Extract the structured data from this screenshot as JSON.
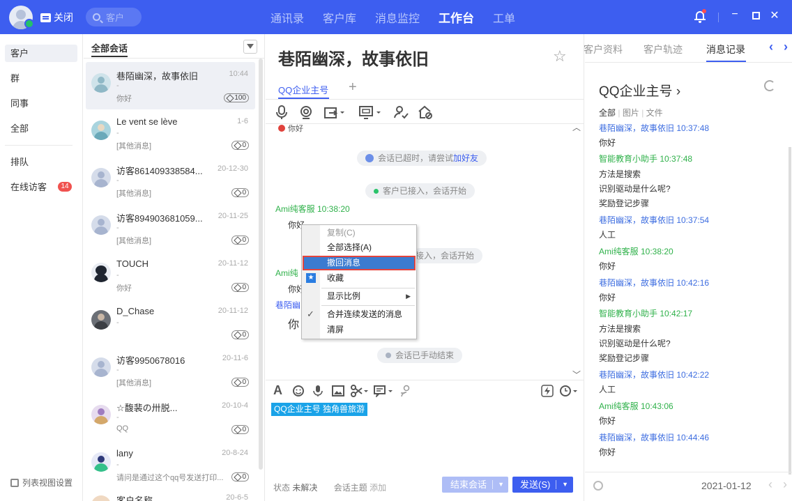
{
  "topbar": {
    "close_label": "关闭",
    "search_placeholder": "客户",
    "tabs": [
      {
        "label": "通讯录"
      },
      {
        "label": "客户库"
      },
      {
        "label": "消息监控"
      },
      {
        "label": "工作台",
        "active": true
      },
      {
        "label": "工单"
      }
    ],
    "accent_color": "#3d5ef0"
  },
  "left_nav": {
    "items": [
      {
        "label": "客户",
        "active": true
      },
      {
        "label": "群"
      },
      {
        "label": "同事"
      },
      {
        "label": "全部"
      },
      {
        "label": "排队"
      },
      {
        "label": "在线访客",
        "badge": "14"
      }
    ],
    "settings_label": "列表视图设置"
  },
  "conversations": {
    "title": "全部会话",
    "items": [
      {
        "name": "巷陌幽深，故事依旧",
        "time": "10:44",
        "sub": "-",
        "msg": "你好",
        "badge": "100",
        "active": true
      },
      {
        "name": "Le vent se lève",
        "time": "1-6",
        "sub": "-",
        "msg": "[其他消息]",
        "badge": "0"
      },
      {
        "name": "访客861409338584...",
        "time": "20-12-30",
        "sub": "-",
        "msg": "[其他消息]",
        "badge": "0"
      },
      {
        "name": "访客894903681059...",
        "time": "20-11-25",
        "sub": "-",
        "msg": "[其他消息]",
        "badge": "0"
      },
      {
        "name": "TOUCH",
        "time": "20-11-12",
        "sub": "-",
        "msg": "你好",
        "badge": "0"
      },
      {
        "name": "D_Chase",
        "time": "20-11-12",
        "sub": "-",
        "msg": "",
        "badge": "0"
      },
      {
        "name": "访客9950678016",
        "time": "20-11-6",
        "sub": "-",
        "msg": "[其他消息]",
        "badge": "0"
      },
      {
        "name": "☆馥裴の卅脱...",
        "time": "20-10-4",
        "sub": "-",
        "msg": "QQ",
        "badge": "0"
      },
      {
        "name": "lany",
        "time": "20-8-24",
        "sub": "-",
        "msg": "请问是通过这个qq号发送打印...",
        "badge": "0"
      },
      {
        "name": "客户名称",
        "time": "20-6-5",
        "sub": "",
        "msg": "",
        "badge": ""
      }
    ]
  },
  "chat": {
    "title": "巷陌幽深，故事依旧",
    "tab_label": "QQ企业主号",
    "add_tab": "+",
    "top_cut_msg": "你好",
    "notices": {
      "timeout_text": "会话已超时，请尝试",
      "timeout_link": "加好友",
      "connected": "客户已接入，会话开始",
      "connected2_partial": "接入，会话开始",
      "ended": "会话已手动结束"
    },
    "messages": [
      {
        "sender": "Ami纯客服  10:38:20",
        "text": "你好"
      },
      {
        "sender": "Ami纯",
        "text": "你好"
      },
      {
        "sender": "巷陌幽",
        "text": "你"
      }
    ],
    "composer_tag": "QQ企业主号  独角兽旅游",
    "status_label": "状态",
    "status_value": "未解决",
    "topic_label": "会话主题",
    "topic_add": "添加",
    "end_button": "结束会话",
    "send_button": "发送(S)"
  },
  "context_menu": {
    "items": [
      {
        "label": "复制(C)",
        "disabled": true
      },
      {
        "label": "全部选择(A)"
      },
      {
        "label": "撤回消息",
        "highlighted": true
      },
      {
        "label": "收藏"
      },
      {
        "label": "显示比例",
        "submenu": true
      },
      {
        "label": "合并连续发送的消息",
        "checked": true
      },
      {
        "label": "清屏"
      }
    ]
  },
  "right_panel": {
    "tabs": [
      {
        "label": "客户资料"
      },
      {
        "label": "客户轨迹"
      },
      {
        "label": "消息记录",
        "active": true
      }
    ],
    "account": "QQ企业主号 ›",
    "filter": {
      "all": "全部",
      "image": "图片",
      "file": "文件",
      "sep": "|"
    },
    "log": [
      {
        "who": "巷陌幽深，故事依旧 10:37:48",
        "color": "#3d6de0",
        "lines": [
          "你好"
        ]
      },
      {
        "who": "智能教育小助手 10:37:48",
        "color": "#2fb14a",
        "lines": [
          "方法是搜索",
          "识别驱动是什么呢?",
          "奖励登记步骤"
        ]
      },
      {
        "who": "巷陌幽深，故事依旧 10:37:54",
        "color": "#3d6de0",
        "lines": [
          "人工"
        ]
      },
      {
        "who": "Ami纯客服 10:38:20",
        "color": "#2fb14a",
        "lines": [
          "你好"
        ]
      },
      {
        "who": "巷陌幽深，故事依旧 10:42:16",
        "color": "#3d6de0",
        "lines": [
          "你好"
        ]
      },
      {
        "who": "智能教育小助手 10:42:17",
        "color": "#2fb14a",
        "lines": [
          "方法是搜索",
          "识别驱动是什么呢?",
          "奖励登记步骤"
        ]
      },
      {
        "who": "巷陌幽深，故事依旧 10:42:22",
        "color": "#3d6de0",
        "lines": [
          "人工"
        ]
      },
      {
        "who": "Ami纯客服 10:43:06",
        "color": "#2fb14a",
        "lines": [
          "你好"
        ]
      },
      {
        "who": "巷陌幽深，故事依旧 10:44:46",
        "color": "#3d6de0",
        "lines": [
          "你好"
        ]
      }
    ],
    "date": "2021-01-12"
  }
}
